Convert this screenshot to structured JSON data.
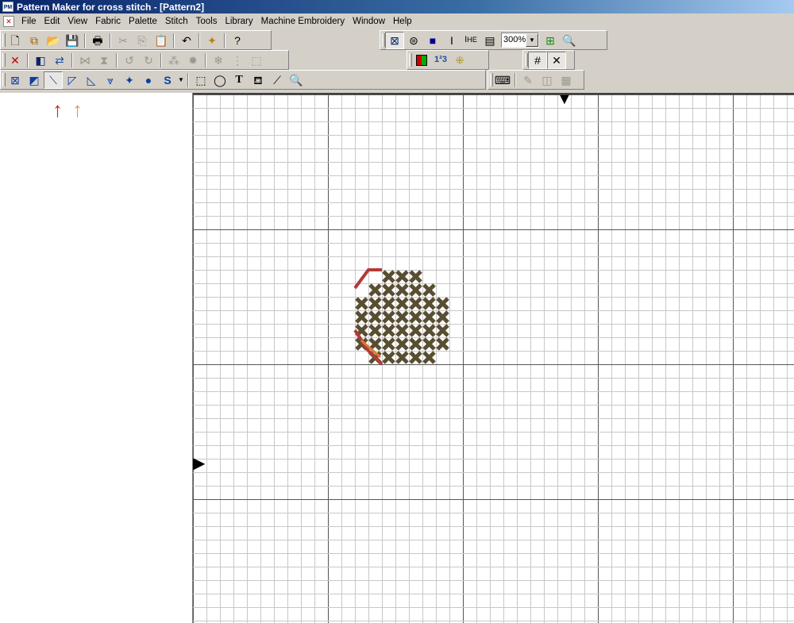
{
  "window": {
    "title": "Pattern Maker for cross stitch - [Pattern2]",
    "app_icon_label": "PM"
  },
  "menu": [
    "File",
    "Edit",
    "View",
    "Fabric",
    "Palette",
    "Stitch",
    "Tools",
    "Library",
    "Machine Embroidery",
    "Window",
    "Help"
  ],
  "toolbar": {
    "zoom_value": "300%",
    "text_tool_label": "T",
    "stitch_s_label": "S",
    "numbers_label": "1²3"
  },
  "annotations": {
    "red_arrow": "↑",
    "orange_arrow": "↑"
  },
  "pattern": {
    "fabric_color": "#ffffff",
    "stitch_color": "#5a4e32",
    "backstitch_color": "#b23a3a",
    "accent_color": "#e07a30"
  }
}
